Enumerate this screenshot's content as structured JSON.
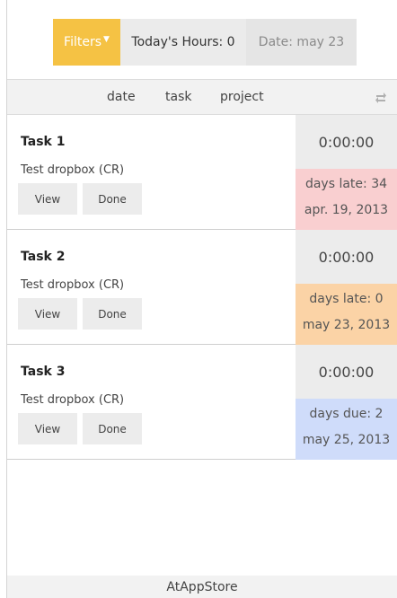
{
  "toolbar": {
    "filters_label": "Filters",
    "hours_label": "Today's Hours: 0",
    "date_label": "Date: may 23"
  },
  "sortbar": {
    "date_label": "date",
    "task_label": "task",
    "project_label": "project"
  },
  "tasks": [
    {
      "title": "Task 1",
      "project": "Test dropbox (CR)",
      "view_label": "View",
      "done_label": "Done",
      "timer": "0:00:00",
      "status_text": "days late: 34",
      "due_date": "apr. 19, 2013",
      "status_color": "#f9cfd0"
    },
    {
      "title": "Task 2",
      "project": "Test dropbox (CR)",
      "view_label": "View",
      "done_label": "Done",
      "timer": "0:00:00",
      "status_text": "days late: 0",
      "due_date": "may 23, 2013",
      "status_color": "#fbd3a6"
    },
    {
      "title": "Task 3",
      "project": "Test dropbox (CR)",
      "view_label": "View",
      "done_label": "Done",
      "timer": "0:00:00",
      "status_text": "days due: 2",
      "due_date": "may 25, 2013",
      "status_color": "#cfdcfa"
    }
  ],
  "footer": {
    "label": "AtAppStore"
  },
  "colors": {
    "accent": "#f5c244"
  }
}
